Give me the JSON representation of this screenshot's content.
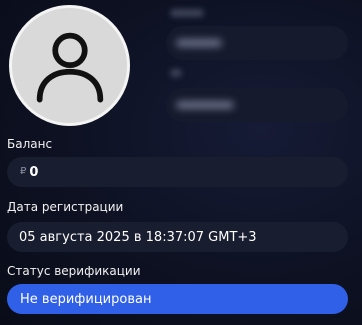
{
  "profile": {
    "avatar_icon": "user-silhouette-icon"
  },
  "balance": {
    "label": "Баланс",
    "currency_symbol": "₽",
    "value": "0"
  },
  "registration": {
    "label": "Дата регистрации",
    "value": "05 августа 2025 в 18:37:07 GMT+3"
  },
  "verification": {
    "label": "Статус верификации",
    "status": "Не верифицирован",
    "status_color": "#3060e8"
  },
  "colors": {
    "background": "#0d1122",
    "field_background": "#181d2f",
    "accent": "#3060e8"
  }
}
